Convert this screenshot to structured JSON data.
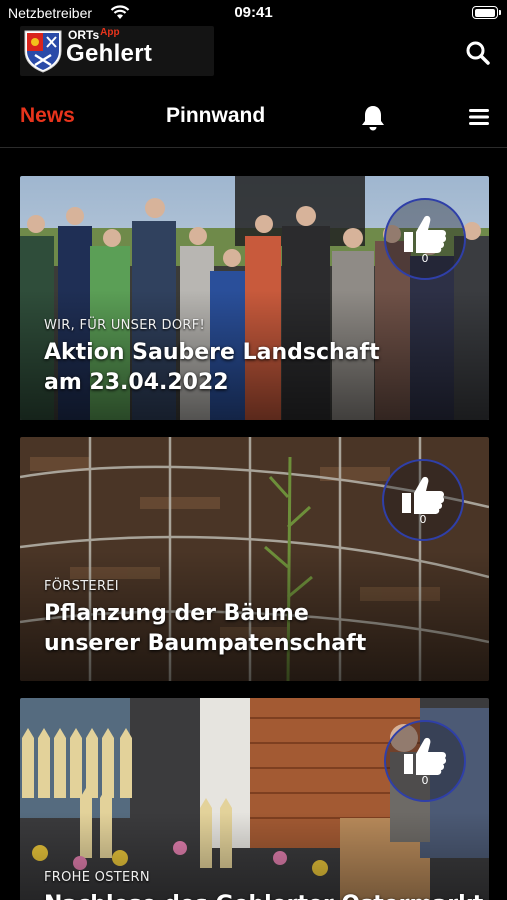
{
  "status_bar": {
    "carrier": "Netzbetreiber",
    "time": "09:41",
    "battery_level": 1.0
  },
  "header": {
    "logo_brand": "ORTs",
    "logo_brand_suffix": "App",
    "logo_town": "Gehlert",
    "search_icon": "search-icon"
  },
  "nav": {
    "tabs": [
      {
        "label": "News",
        "active": true,
        "color": "#e8341c"
      },
      {
        "label": "Pinnwand",
        "active": false
      }
    ],
    "bell_icon": "bell-icon",
    "menu_icon": "hamburger-menu-icon"
  },
  "feed": {
    "items": [
      {
        "category": "WIR, FÜR UNSER DORF!",
        "title": "Aktion Saubere Landschaft am 23.04.2022",
        "likes": "0",
        "image": "group-photo-outdoor"
      },
      {
        "category": "FÖRSTEREI",
        "title": "Pflanzung der Bäume unserer Baumpatenschaft",
        "likes": "0",
        "image": "young-tree-in-wire-fence"
      },
      {
        "category": "FROHE OSTERN",
        "title": "Nachlese des Gehlerter Ostermarkt",
        "likes": "0",
        "image": "easter-market-decoration"
      }
    ]
  },
  "colors": {
    "accent": "#e8341c",
    "background": "#000000",
    "like_ring": "#2f3fa8"
  }
}
